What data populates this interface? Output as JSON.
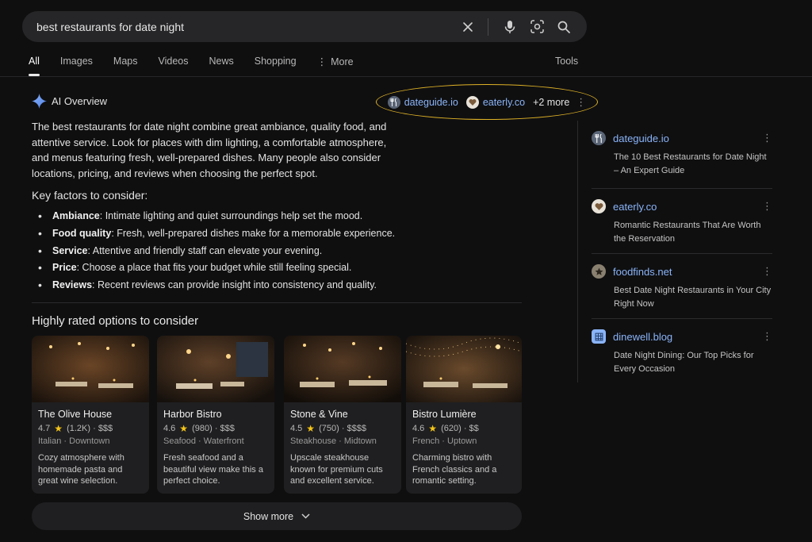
{
  "search": {
    "query": "best restaurants for date night"
  },
  "tabs": [
    {
      "label": "All",
      "active": true
    },
    {
      "label": "Images"
    },
    {
      "label": "Maps"
    },
    {
      "label": "Videos"
    },
    {
      "label": "News"
    },
    {
      "label": "Shopping"
    },
    {
      "label": "More"
    }
  ],
  "tools_label": "Tools",
  "ai_overview": {
    "title": "AI Overview",
    "sources": [
      {
        "label": "dateguide.io",
        "icon": "fork-knife-icon"
      },
      {
        "label": "eaterly.co",
        "icon": "heart-icon"
      }
    ],
    "more_label": "+2 more",
    "summary": "The best restaurants for date night combine great ambiance, quality food, and attentive service. Look for places with dim lighting, a comfortable atmosphere, and menus featuring fresh, well-prepared dishes. Many people also consider locations, pricing, and reviews when choosing the perfect spot.",
    "key_factors_title": "Key factors to consider:",
    "key_factors": [
      {
        "term": "Ambiance",
        "text": ": Intimate lighting and quiet surroundings help set the mood."
      },
      {
        "term": "Food quality",
        "text": ": Fresh, well-prepared dishes make for a memorable experience."
      },
      {
        "term": "Service",
        "text": ": Attentive and friendly staff can elevate your evening."
      },
      {
        "term": "Price",
        "text": ": Choose a place that fits your budget while still feeling special."
      },
      {
        "term": "Reviews",
        "text": ": Recent reviews can provide insight into consistency and quality."
      }
    ]
  },
  "options": {
    "title": "Highly rated options to consider",
    "cards": [
      {
        "name": "The Olive House",
        "rating": "4.7",
        "reviews": "(1.2K)",
        "price": "· $$$",
        "category": "Italian · Downtown",
        "desc": "Cozy atmosphere with homemade pasta and great wine selection."
      },
      {
        "name": "Harbor Bistro",
        "rating": "4.6",
        "reviews": "(980)",
        "price": "· $$$",
        "category": "Seafood · Waterfront",
        "desc": "Fresh seafood and a beautiful view make this a perfect choice."
      },
      {
        "name": "Stone & Vine",
        "rating": "4.5",
        "reviews": "(750)",
        "price": "· $$$$",
        "category": "Steakhouse · Midtown",
        "desc": "Upscale steakhouse known for premium cuts and excellent service."
      },
      {
        "name": "Bistro Lumière",
        "rating": "4.6",
        "reviews": "(620)",
        "price": "· $$",
        "category": "French · Uptown",
        "desc": "Charming bistro with French classics and a romantic setting."
      }
    ],
    "show_more": "Show more"
  },
  "source_panel": [
    {
      "domain": "dateguide.io",
      "title": "The 10 Best Restaurants for Date Night – An Expert Guide",
      "icon": "fork-knife-icon"
    },
    {
      "domain": "eaterly.co",
      "title": "Romantic Restaurants That Are Worth the Reservation",
      "icon": "heart-icon"
    },
    {
      "domain": "foodfinds.net",
      "title": "Best Date Night Restaurants in Your City Right Now",
      "icon": "star-icon"
    },
    {
      "domain": "dinewell.blog",
      "title": "Date Night Dining: Our Top Picks for Every Occasion",
      "icon": "grid-icon"
    }
  ],
  "colors": {
    "link": "#8ab4f8",
    "accent_ring": "#e0b326",
    "star": "#f5c518",
    "background": "#0f0f10"
  }
}
